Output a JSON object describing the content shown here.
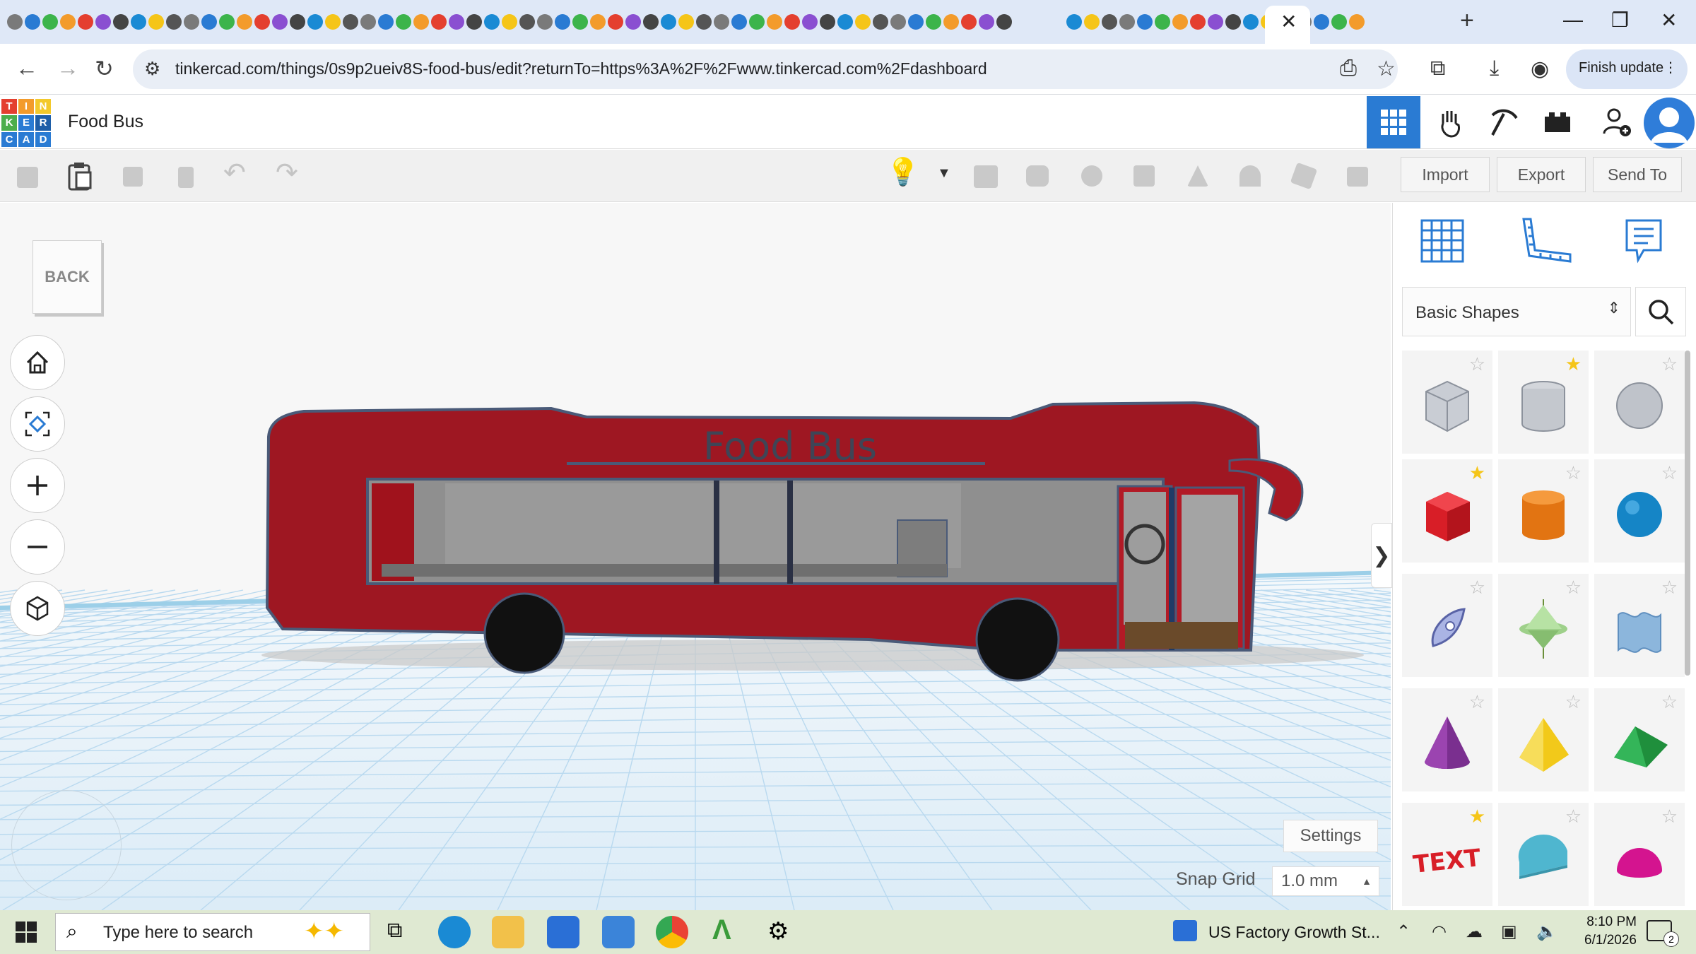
{
  "browser": {
    "url": "tinkercad.com/things/0s9p2ueiv8S-food-bus/edit?returnTo=https%3A%2F%2Fwww.tinkercad.com%2Fdashboard",
    "finish_update_label": "Finish update"
  },
  "app": {
    "logo_letters": [
      "T",
      "I",
      "N",
      "K",
      "E",
      "R",
      "C",
      "A",
      "D"
    ],
    "project_title": "Food Bus"
  },
  "toolbar": {
    "import_label": "Import",
    "export_label": "Export",
    "send_to_label": "Send To"
  },
  "workplane": {
    "back_label": "BACK",
    "bus_text": "Food  Bus",
    "settings_label": "Settings",
    "snap_grid_label": "Snap Grid",
    "snap_grid_value": "1.0 mm"
  },
  "panel": {
    "library_selected": "Basic Shapes",
    "shapes": [
      {
        "name": "box-hole",
        "favorite": false
      },
      {
        "name": "cylinder-hole",
        "favorite": true
      },
      {
        "name": "sphere-hole",
        "favorite": false
      },
      {
        "name": "box",
        "favorite": true
      },
      {
        "name": "cylinder",
        "favorite": false
      },
      {
        "name": "sphere",
        "favorite": false
      },
      {
        "name": "scribble",
        "favorite": false
      },
      {
        "name": "shape-generator",
        "favorite": false
      },
      {
        "name": "wave",
        "favorite": false
      },
      {
        "name": "cone",
        "favorite": false
      },
      {
        "name": "pyramid",
        "favorite": false
      },
      {
        "name": "roof",
        "favorite": false
      },
      {
        "name": "text",
        "favorite": true
      },
      {
        "name": "half-cylinder",
        "favorite": false
      },
      {
        "name": "half-sphere",
        "favorite": false
      }
    ],
    "text_shape_label": "TEXT"
  },
  "taskbar": {
    "search_placeholder": "Type here to search",
    "news_text": "US Factory Growth St...",
    "time": "8:10 PM",
    "date": "6/1/2026",
    "notification_count": "2"
  },
  "colors": {
    "tinkercad_blue": "#2a7bd3",
    "bus_red": "#9e1722",
    "workplane_grid": "#b9d9ef",
    "favorite_star": "#f5c518"
  }
}
